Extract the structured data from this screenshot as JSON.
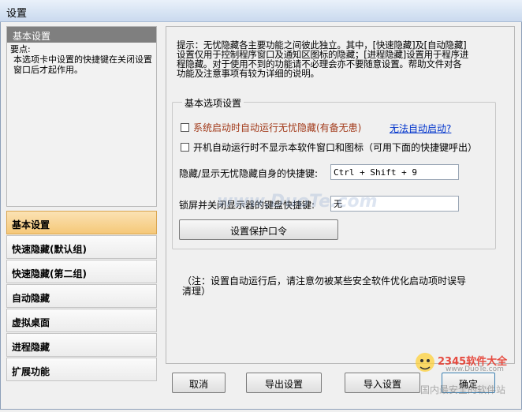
{
  "window": {
    "title": "设置"
  },
  "info_panel": {
    "header": "基本设置",
    "label": "要点:",
    "text": "本选项卡中设置的快捷键在关闭设置窗口后才起作用。"
  },
  "nav": {
    "items": [
      {
        "label": "基本设置",
        "active": true
      },
      {
        "label": "快速隐藏(默认组)",
        "active": false
      },
      {
        "label": "快速隐藏(第二组)",
        "active": false
      },
      {
        "label": "自动隐藏",
        "active": false
      },
      {
        "label": "虚拟桌面",
        "active": false
      },
      {
        "label": "进程隐藏",
        "active": false
      },
      {
        "label": "扩展功能",
        "active": false
      }
    ]
  },
  "main": {
    "hint": "提示：无忧隐藏各主要功能之间彼此独立。其中，[快速隐藏]及[自动隐藏]设置仅用于控制程序窗口及通知区图标的隐藏；[进程隐藏]设置用于程序进程隐藏。对于使用不到的功能请不必理会亦不要随意设置。帮助文件对各功能及注意事项有较为详细的说明。",
    "group_title": "基本选项设置",
    "autostart_label": "系统启动时自动运行无忧隐藏(有备无患)",
    "autostart_link": "无法自动启动?",
    "hide_window_label": "开机自动运行时不显示本软件窗口和图标（可用下面的快捷键呼出）",
    "hotkey_label": "隐藏/显示无忧隐藏自身的快捷键:",
    "hotkey_value": "Ctrl + Shift + 9",
    "lock_label": "锁屏并关闭显示器的键盘快捷键:",
    "lock_value": "无",
    "protect_btn": "设置保护口令",
    "note": "（注：设置自动运行后，请注意勿被某些安全软件优化启动项时误导清理）"
  },
  "footer": {
    "cancel": "取消",
    "export": "导出设置",
    "import": "导入设置",
    "ok": "确定"
  },
  "watermarks": {
    "center": "www.DuoTe.com",
    "logo_brand": "2345软件大全",
    "logo_url": "www.DuoTe.com",
    "logo_slogan": "国内最安全的软件站"
  },
  "colors": {
    "active_nav": "#f5c878",
    "link": "#0033cc",
    "autostart_text": "#a23a1a"
  }
}
